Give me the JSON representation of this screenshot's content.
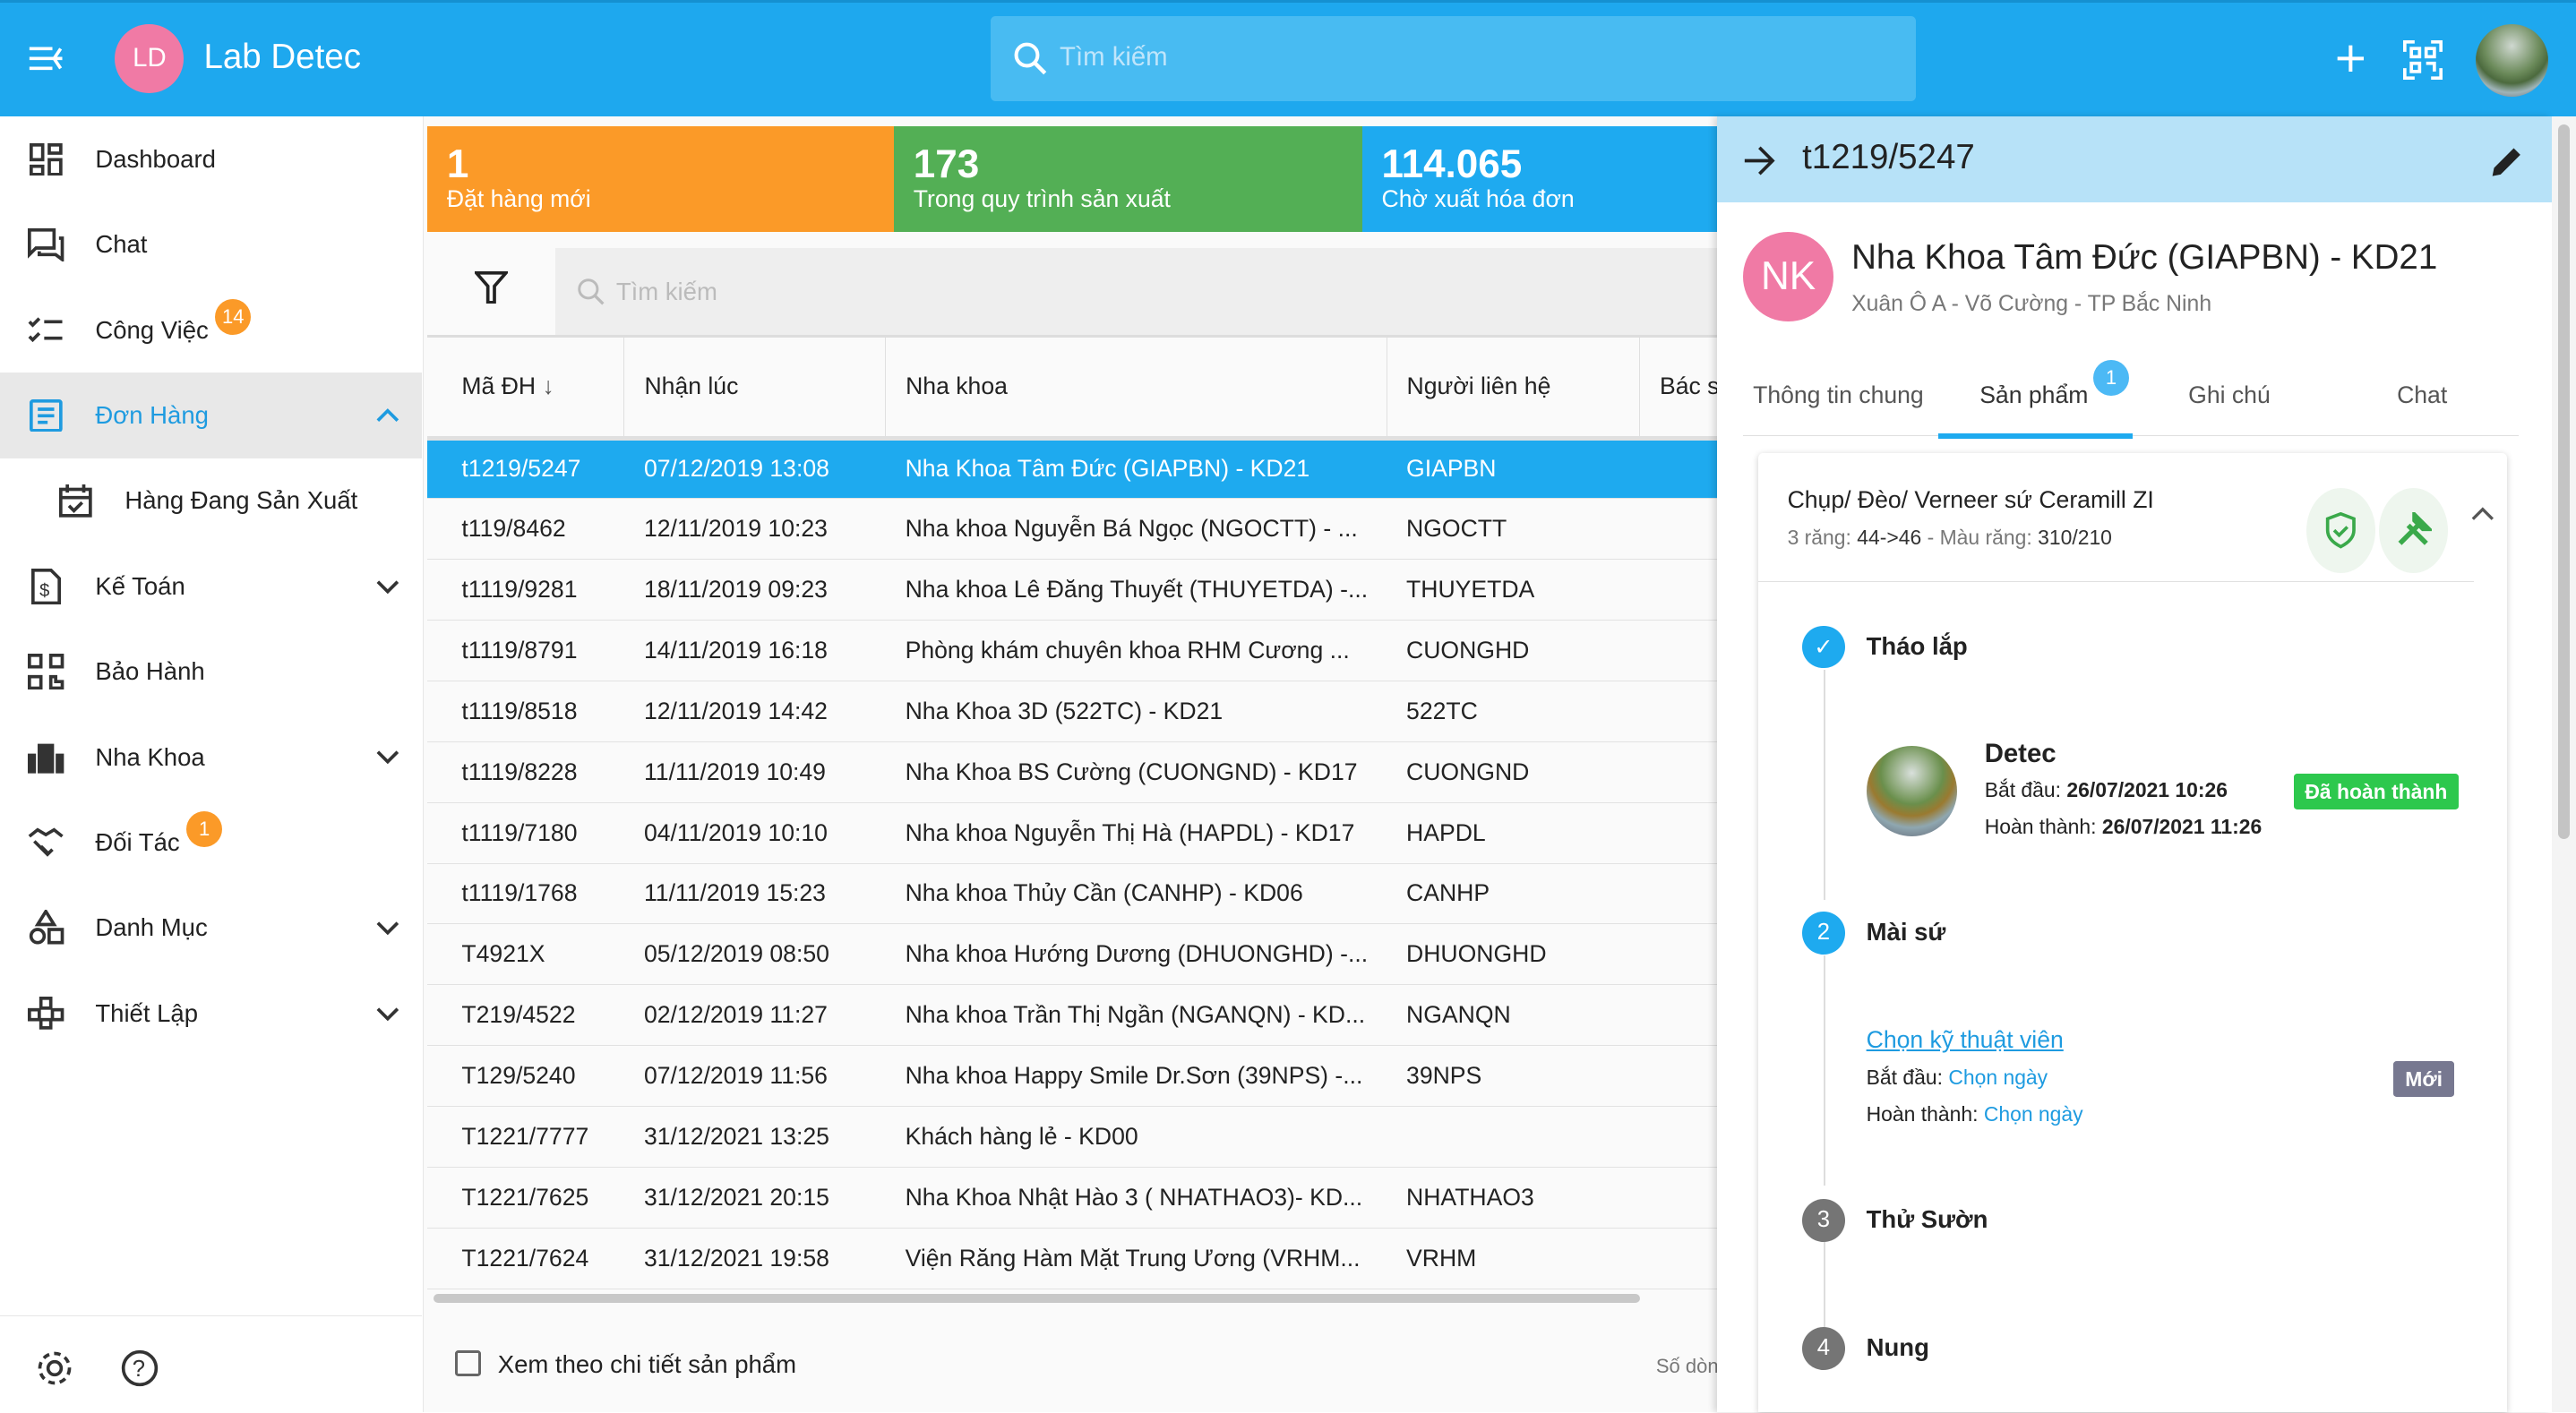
{
  "header": {
    "avatar_initials": "LD",
    "app_title": "Lab Detec",
    "search_placeholder": "Tìm kiếm",
    "icons": [
      "menu-icon",
      "search-icon",
      "plus-icon",
      "qr-scan-icon",
      "user-avatar"
    ]
  },
  "sidebar": {
    "items": [
      {
        "label": "Dashboard",
        "icon": "dashboard-icon"
      },
      {
        "label": "Chat",
        "icon": "chat-icon"
      },
      {
        "label": "Công Việc",
        "icon": "checklist-icon",
        "badge": "14"
      },
      {
        "label": "Đơn Hàng",
        "icon": "order-icon",
        "active": true,
        "expanded": true
      },
      {
        "label": "Hàng Đang Sản Xuất",
        "icon": "calendar-check-icon",
        "sub": true
      },
      {
        "label": "Kế Toán",
        "icon": "accounting-icon",
        "expandable": true
      },
      {
        "label": "Bảo Hành",
        "icon": "qr-icon"
      },
      {
        "label": "Nha Khoa",
        "icon": "building-icon",
        "expandable": true
      },
      {
        "label": "Đối Tác",
        "icon": "handshake-icon",
        "badge": "1"
      },
      {
        "label": "Danh Mục",
        "icon": "category-icon",
        "expandable": true
      },
      {
        "label": "Thiết Lập",
        "icon": "settings-tree-icon",
        "expandable": true
      }
    ],
    "footer_icons": [
      "settings-icon",
      "help-icon"
    ]
  },
  "stats": [
    {
      "value": "1",
      "label": "Đặt hàng mới",
      "color": "#fb9a28"
    },
    {
      "value": "173",
      "label": "Trong quy trình sản xuất",
      "color": "#53af55"
    },
    {
      "value": "114.065",
      "label": "Chờ xuất hóa đơn",
      "color": "#1eaaf0"
    }
  ],
  "orders": {
    "search_placeholder": "Tìm kiếm",
    "columns": [
      "Mã ĐH",
      "Nhận lúc",
      "Nha khoa",
      "Người liên hệ",
      "Bác s"
    ],
    "rows": [
      [
        "t1219/5247",
        "07/12/2019 13:08",
        "Nha Khoa Tâm Đức (GIAPBN) - KD21",
        "GIAPBN"
      ],
      [
        "t119/8462",
        "12/11/2019 10:23",
        "Nha khoa Nguyễn Bá Ngọc (NGOCTT) - ...",
        "NGOCTT"
      ],
      [
        "t1119/9281",
        "18/11/2019 09:23",
        "Nha khoa Lê Đăng Thuyết (THUYETDA) -...",
        "THUYETDA"
      ],
      [
        "t1119/8791",
        "14/11/2019 16:18",
        "Phòng khám chuyên khoa RHM Cương ...",
        "CUONGHD"
      ],
      [
        "t1119/8518",
        "12/11/2019 14:42",
        "Nha Khoa 3D (522TC) - KD21",
        "522TC"
      ],
      [
        "t1119/8228",
        "11/11/2019 10:49",
        "Nha Khoa BS Cường (CUONGND) - KD17",
        "CUONGND"
      ],
      [
        "t1119/7180",
        "04/11/2019 10:10",
        "Nha khoa Nguyễn Thị Hà (HAPDL) - KD17",
        "HAPDL"
      ],
      [
        "t1119/1768",
        "11/11/2019 15:23",
        "Nha khoa Thủy Cần (CANHP) - KD06",
        "CANHP"
      ],
      [
        "T4921X",
        "05/12/2019 08:50",
        "Nha khoa Hướng Dương (DHUONGHD) -...",
        "DHUONGHD"
      ],
      [
        "T219/4522",
        "02/12/2019 11:27",
        "Nha khoa Trần Thị Ngần (NGANQN) - KD...",
        "NGANQN"
      ],
      [
        "T129/5240",
        "07/12/2019 11:56",
        "Nha khoa Happy Smile Dr.Sơn (39NPS) -...",
        "39NPS"
      ],
      [
        "T1221/7777",
        "31/12/2021 13:25",
        "Khách hàng lẻ - KD00",
        ""
      ],
      [
        "T1221/7625",
        "31/12/2021 20:15",
        "Nha Khoa Nhật Hào 3 ( NHATHAO3)- KD...",
        "NHATHAO3"
      ],
      [
        "T1221/7624",
        "31/12/2021 19:58",
        "Viện Răng Hàm Mặt Trung Ương (VRHM...",
        "VRHM"
      ]
    ],
    "footer_checkbox": "Xem theo chi tiết sản phẩm",
    "footer_right": "Số dòn"
  },
  "detail": {
    "order_id": "t1219/5247",
    "clinic_initials": "NK",
    "clinic_name": "Nha Khoa Tâm Đức (GIAPBN) - KD21",
    "clinic_address": "Xuân Ô A - Võ Cường - TP Bắc Ninh",
    "tabs": [
      "Thông tin chung",
      "Sản phẩm",
      "Ghi chú",
      "Chat"
    ],
    "active_tab": "Sản phẩm",
    "tab_badge": "1",
    "product": {
      "name": "Chụp/ Đèo/ Verneer sứ Ceramill ZI",
      "teeth_label": "3 răng:",
      "teeth": "44->46",
      "shade_label": " - Màu răng:",
      "shade": "310/210"
    },
    "steps": [
      {
        "num": "✓",
        "title": "Tháo lắp",
        "done": true,
        "worker": "Detec",
        "start_label": "Bắt đầu:",
        "start": "26/07/2021 10:26",
        "end_label": "Hoàn thành:",
        "end": "26/07/2021 11:26",
        "status": "Đã hoàn thành",
        "status_color": "#2dc84d"
      },
      {
        "num": "2",
        "title": "Mài sứ",
        "pick_tech": "Chọn kỹ thuật viên",
        "start_label": "Bắt đầu:",
        "start": "Chọn ngày",
        "end_label": "Hoàn thành:",
        "end": "Chọn ngày",
        "status": "Mới",
        "status_color": "#777890"
      },
      {
        "num": "3",
        "title": "Thử Sườn"
      },
      {
        "num": "4",
        "title": "Nung"
      }
    ]
  }
}
